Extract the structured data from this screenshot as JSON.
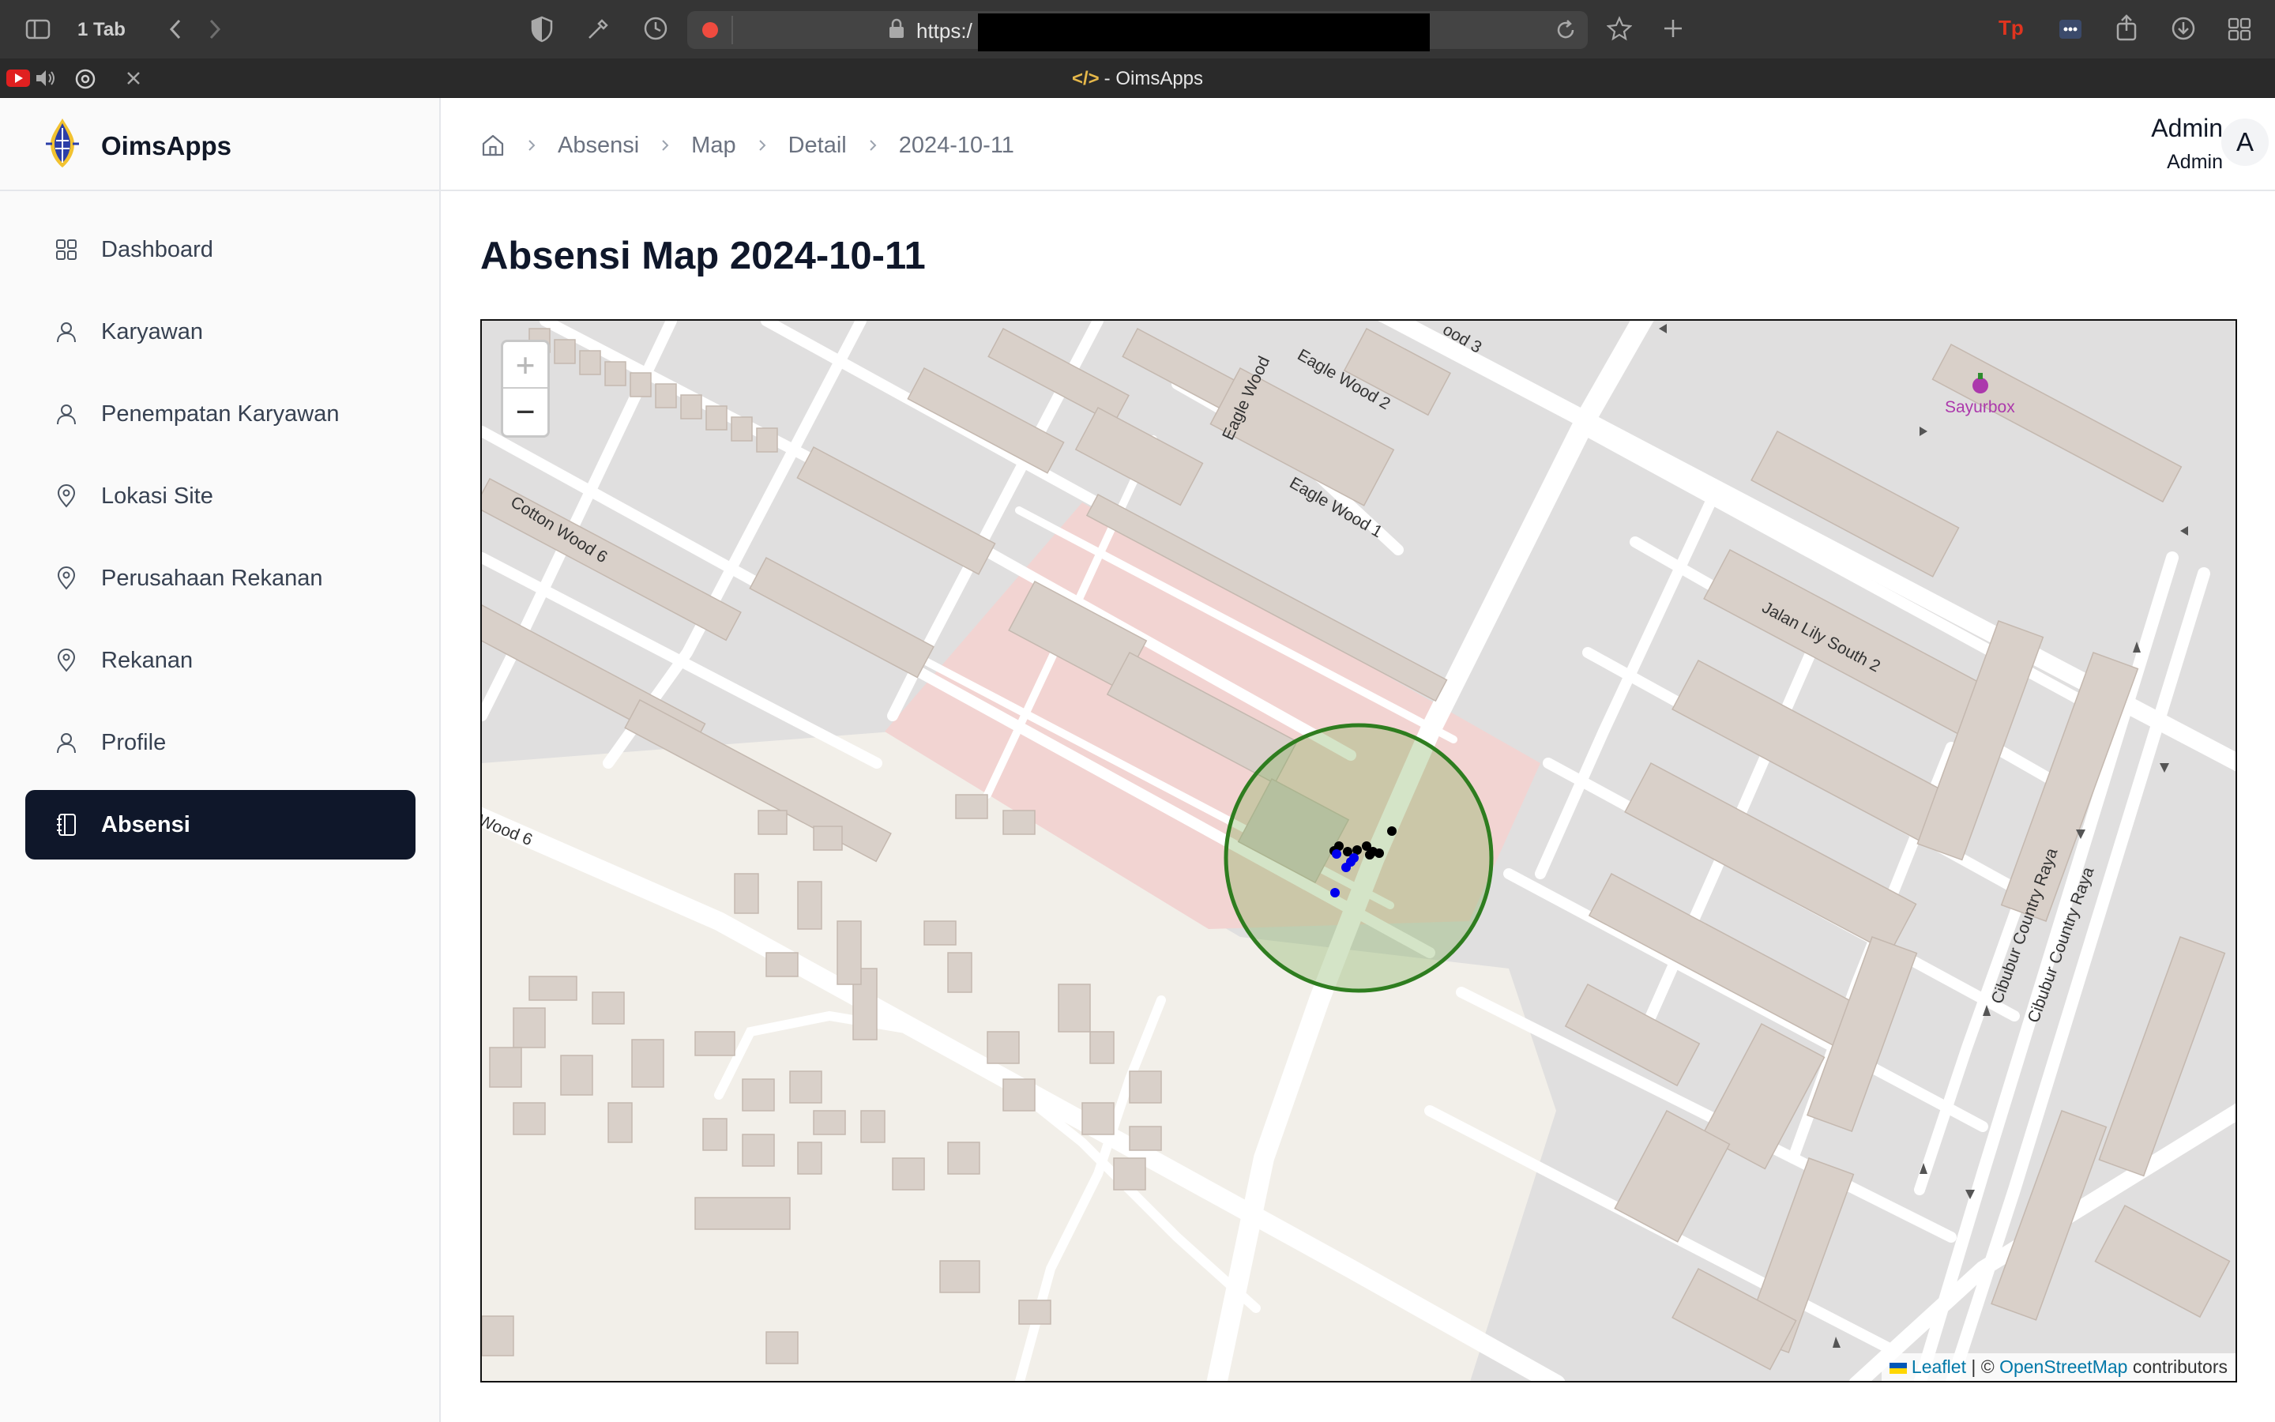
{
  "browser": {
    "tab_count": "1 Tab",
    "url": "https:/",
    "tab_title_code": "</>",
    "tab_title": "- OimsApps"
  },
  "app": {
    "brand": "OimsApps",
    "nav": [
      {
        "label": "Dashboard",
        "icon": "grid-icon"
      },
      {
        "label": "Karyawan",
        "icon": "user-icon"
      },
      {
        "label": "Penempatan Karyawan",
        "icon": "user-icon"
      },
      {
        "label": "Lokasi Site",
        "icon": "map-pin-icon"
      },
      {
        "label": "Perusahaan Rekanan",
        "icon": "map-pin-icon"
      },
      {
        "label": "Rekanan",
        "icon": "map-pin-icon"
      },
      {
        "label": "Profile",
        "icon": "user-icon"
      },
      {
        "label": "Absensi",
        "icon": "notebook-icon",
        "active": true
      }
    ]
  },
  "header": {
    "breadcrumbs": [
      "Absensi",
      "Map",
      "Detail",
      "2024-10-11"
    ],
    "user_name": "Admin",
    "user_role": "Admin",
    "avatar_initial": "A"
  },
  "page": {
    "title": "Absensi Map 2024-10-11"
  },
  "map": {
    "zoom_in": "+",
    "zoom_out": "−",
    "attribution_leaflet": "Leaflet",
    "attribution_sep": "| ©",
    "attribution_osm": "OpenStreetMap",
    "attribution_tail": "contributors",
    "street_labels": {
      "eagle_wood": "Eagle Wood",
      "eagle_wood_2": "Eagle Wood 2",
      "eagle_wood_1": "Eagle Wood 1",
      "wood_3": "ood 3",
      "cotton_wood_6": "Cotton Wood 6",
      "wood_6": "Wood 6",
      "lily_south_2": "Jalan Lily South 2",
      "cibubur_1": "Cibubur Country Raya",
      "cibubur_2": "Cibubur Country Raya"
    },
    "poi": "Sayurbox",
    "geofence_color": "#2e7d1f",
    "marker_colors": [
      "#000000",
      "#0000ee"
    ]
  }
}
